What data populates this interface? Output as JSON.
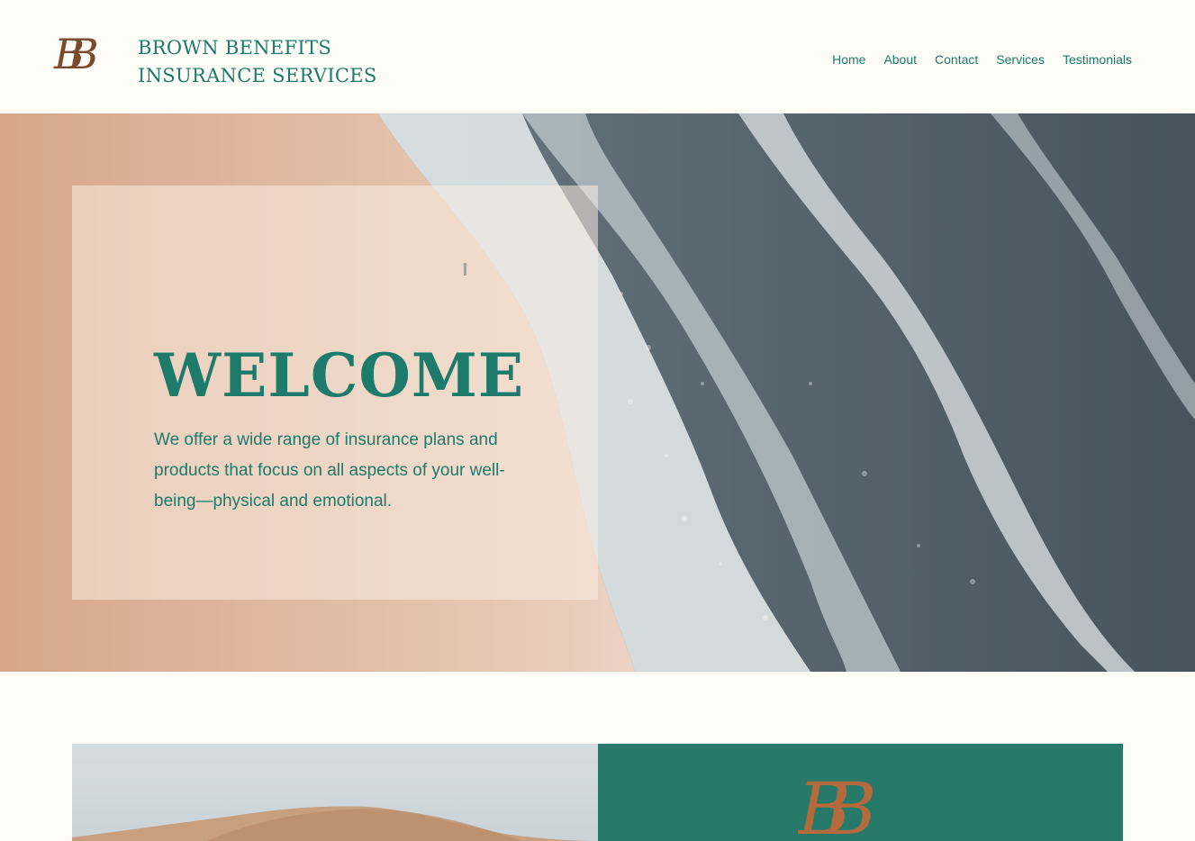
{
  "header": {
    "brand_line1": "BROWN BENEFITS",
    "brand_line2": "INSURANCE SERVICES",
    "logo_text": "BB"
  },
  "nav": {
    "items": [
      {
        "label": "Home"
      },
      {
        "label": "About"
      },
      {
        "label": "Contact"
      },
      {
        "label": "Services"
      },
      {
        "label": "Testimonials"
      }
    ]
  },
  "hero": {
    "title": "WELCOME",
    "text": "We offer a wide range of insurance plans and products that focus on all aspects of your well-being—physical and emotional."
  },
  "lower": {
    "logo_text": "BB"
  },
  "colors": {
    "accent": "#1e7a6b",
    "panel": "#277a6a",
    "logo_brown": "#7a4a2e",
    "background": "#fdfcf7"
  }
}
